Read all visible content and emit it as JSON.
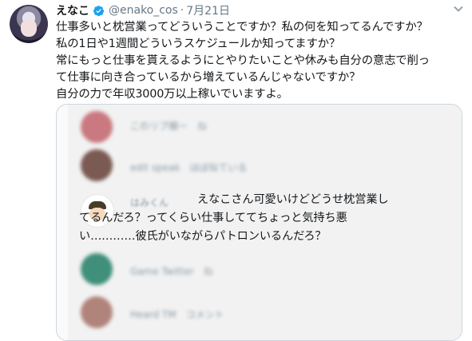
{
  "tweet": {
    "display_name": "えなこ",
    "handle": "@enako_cos",
    "separator": "·",
    "date": "7月21日",
    "lines": [
      "仕事多いと枕営業ってどういうことですか？私の何を知ってるんですか？",
      "私の1日や1週間どういうスケジュールか知ってますか？",
      "常にもっと仕事を貰えるようにとやりたいことや休みも自分の意志で削っ",
      "て仕事に向き合っているから増えているんじゃないですか？",
      "自分の力で年収3000万以上稼いでいますよ。"
    ]
  },
  "quoted": {
    "reply_lines": [
      "えなこさん可愛いけどどうせ枕営業し",
      "てるんだろ？ってくらい仕事しててちょっと気持ち悪",
      "い…………彼氏がいながらパトロンいるんだろ？"
    ],
    "reply_user_blurred": "はみくん",
    "blurred_rows": [
      {
        "text": "このリプ欄ー　ね",
        "color": "#c9797f"
      },
      {
        "text": "edit speak　ほぼ似ている",
        "color": "#7a5a52"
      },
      {
        "text": "Game Twitter　ね",
        "color": "#3f8f7a"
      },
      {
        "text": "Heard TM　コメント",
        "color": "#b0847a"
      }
    ]
  },
  "colors": {
    "verified": "#1da1f2",
    "muted": "#657786",
    "border": "#ccd6dd"
  }
}
